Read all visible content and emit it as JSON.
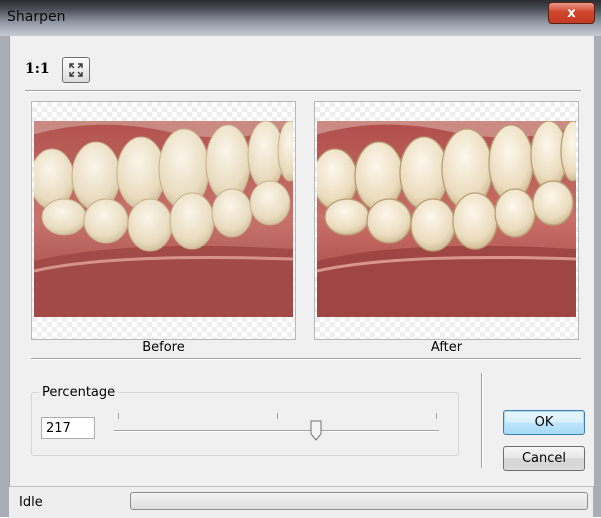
{
  "window": {
    "title": "Sharpen",
    "close_glyph": "x"
  },
  "toolbar": {
    "zoom_label": "1:1",
    "fit_icon": "fit-to-window-icon"
  },
  "preview": {
    "before_caption": "Before",
    "after_caption": "After"
  },
  "percentage": {
    "group_label": "Percentage",
    "value": "217",
    "slider_level": 0.62
  },
  "buttons": {
    "ok_label": "OK",
    "cancel_label": "Cancel"
  },
  "status": {
    "text": "Idle",
    "progress": 0
  },
  "colors": {
    "accent": "#3c7fb1",
    "close": "#c23b22",
    "gum": "#b35a55",
    "tooth": "#efe7d2"
  }
}
